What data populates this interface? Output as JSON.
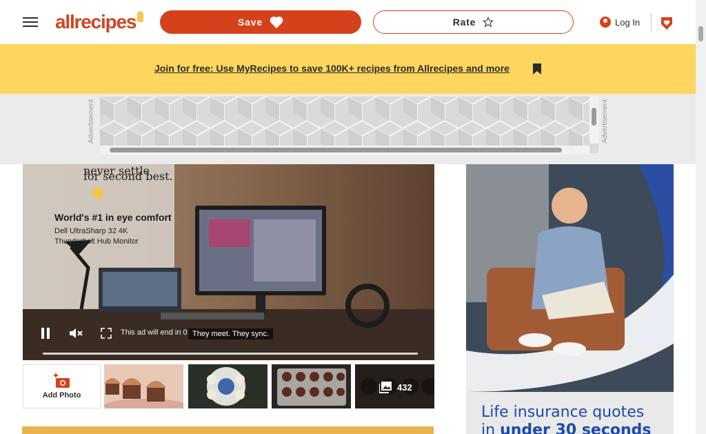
{
  "header": {
    "menu_icon": "hamburger-menu-icon",
    "logo_text": "allrecipes",
    "save_label": "Save",
    "save_icon": "heart-outline-icon",
    "rate_label": "Rate",
    "rate_icon": "star-outline-icon",
    "login_label": "Log In",
    "login_icon": "user-circle-icon",
    "heart_icon": "heart-shield-icon"
  },
  "banner": {
    "text": "Join for free: Use MyRecipes to save 100K+ recipes from Allrecipes and more",
    "bookmark_icon": "bookmark-icon"
  },
  "ads": {
    "label": "Advertisement"
  },
  "video": {
    "line1": "never settle",
    "line2": "for second best.",
    "headline": "World's #1 in eye comfort",
    "product1": "Dell UltraSharp 32 4K",
    "product2": "Thunderbolt Hub Monitor",
    "caption": "They meet. They sync.",
    "ad_end_text": "This ad will end in 0",
    "progress": 1.0
  },
  "photos": {
    "add_label": "Add Photo",
    "count": "432",
    "count_icon": "gallery-icon"
  },
  "right_ad": {
    "line1": "Life insurance quotes",
    "line2_pre": "in ",
    "line2_bold": "under 30 seconds"
  },
  "colors": {
    "brand": "#d5411a",
    "banner": "#fcd65e",
    "ad_blue": "#1d4aa8"
  }
}
